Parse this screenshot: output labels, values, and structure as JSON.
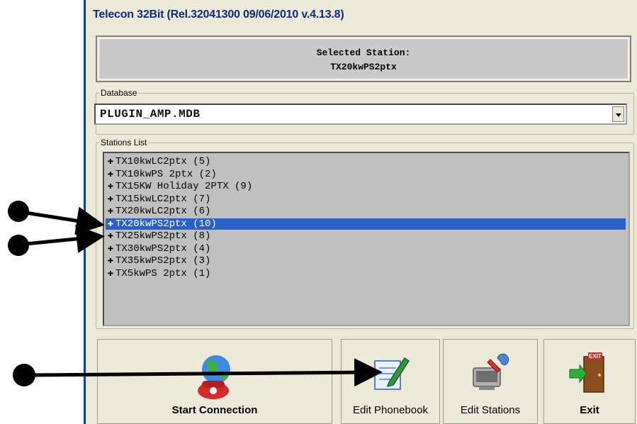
{
  "window": {
    "title": "Telecon 32Bit (Rel.32041300 09/06/2010 v.4.13.8)"
  },
  "selected_station": {
    "label": "Selected Station:",
    "value": "TX20kwPS2ptx"
  },
  "database": {
    "legend": "Database",
    "value": "PLUGIN_AMP.MDB"
  },
  "stations": {
    "legend": "Stations List",
    "items": [
      "TX10kwLC2ptx (5)",
      "TX10kwPS 2ptx (2)",
      "TX15KW Holiday 2PTX (9)",
      "TX15kwLC2ptx (7)",
      "TX20kwLC2ptx (6)",
      "TX20kwPS2ptx (10)",
      "TX25kwPS2ptx (8)",
      "TX30kwPS2ptx (4)",
      "TX35kwPS2ptx (3)",
      "TX5kwPS 2ptx (1)"
    ],
    "selected_index": 5
  },
  "buttons": {
    "start": "Start Connection",
    "phonebook": "Edit Phonebook",
    "stations": "Edit Stations",
    "exit": "Exit"
  },
  "icons": {
    "start": "globe-phone-icon",
    "phonebook": "notepad-pencil-icon",
    "stations": "computer-tools-icon",
    "exit": "exit-door-icon",
    "expand": "plus-icon"
  },
  "exit_sign": "EXIT",
  "colors": {
    "selection": "#2a5ec8",
    "title_text": "#0f2a7a",
    "list_bg": "#c0c0c0",
    "face": "#ece9d8"
  }
}
